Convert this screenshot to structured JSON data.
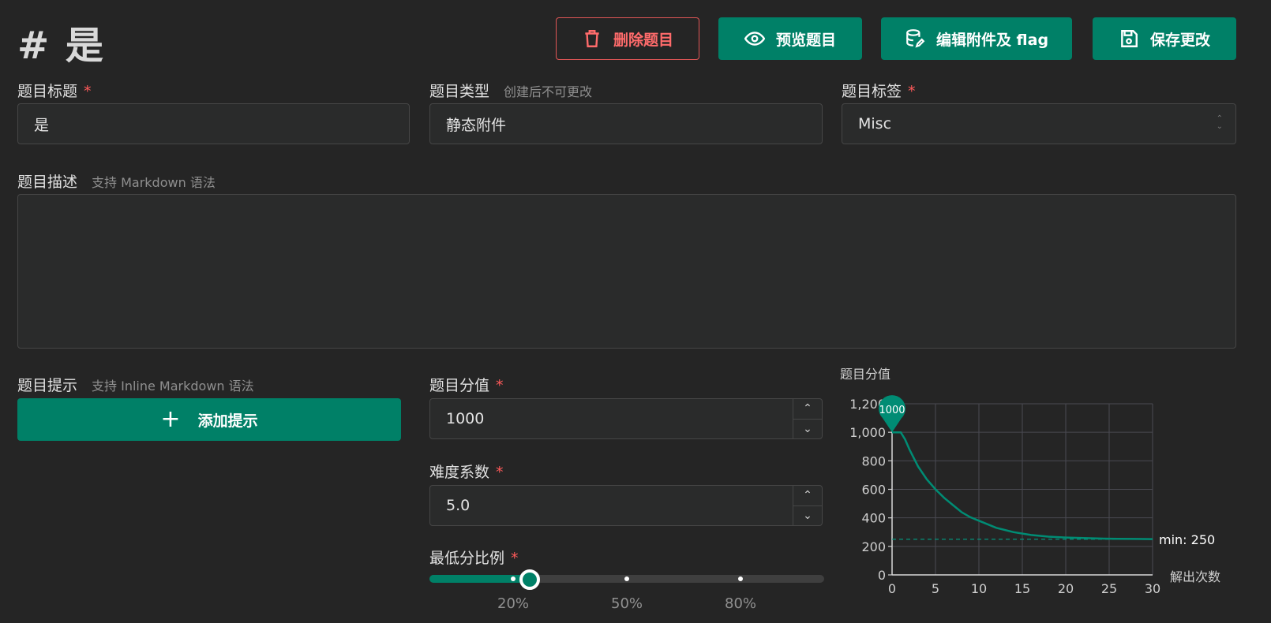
{
  "header": {
    "title": "# 是"
  },
  "toolbar": {
    "delete_label": "删除题目",
    "preview_label": "预览题目",
    "edit_attachments_label": "编辑附件及 flag",
    "save_label": "保存更改"
  },
  "form": {
    "title": {
      "label": "题目标题",
      "required": "*",
      "value": "是"
    },
    "type": {
      "label": "题目类型",
      "hint": "创建后不可更改",
      "value": "静态附件"
    },
    "tag": {
      "label": "题目标签",
      "required": "*",
      "value": "Misc"
    },
    "description": {
      "label": "题目描述",
      "hint": "支持 Markdown 语法",
      "value": ""
    },
    "hints": {
      "label": "题目提示",
      "hint": "支持 Inline Markdown 语法",
      "add_label": "添加提示"
    },
    "score": {
      "label": "题目分值",
      "required": "*",
      "value": "1000"
    },
    "difficulty": {
      "label": "难度系数",
      "required": "*",
      "value": "5.0"
    },
    "min_ratio": {
      "label": "最低分比例",
      "required": "*",
      "value": 0.25,
      "marks": [
        "20%",
        "50%",
        "80%"
      ]
    }
  },
  "colors": {
    "accent": "#008067",
    "danger": "#ff5a5a"
  },
  "chart_data": {
    "type": "line",
    "ylabel": "题目分值",
    "xlabel": "解出次数",
    "xlim": [
      0,
      30
    ],
    "ylim": [
      0,
      1200
    ],
    "xticks": [
      "0",
      "5",
      "10",
      "15",
      "20",
      "25",
      "30"
    ],
    "yticks": [
      "0",
      "200",
      "400",
      "600",
      "800",
      "1,000",
      "1,200"
    ],
    "x": [
      0,
      0.5,
      1,
      1.5,
      2,
      3,
      4,
      5,
      6,
      7,
      8,
      9,
      10,
      12,
      14,
      16,
      18,
      20,
      22,
      24,
      26,
      28,
      30
    ],
    "y": [
      1000,
      1000,
      1000,
      950,
      880,
      760,
      670,
      600,
      540,
      490,
      440,
      405,
      380,
      330,
      300,
      280,
      268,
      262,
      258,
      255,
      253,
      252,
      251
    ],
    "marker": {
      "x": 0,
      "y": 1000,
      "label": "1000"
    },
    "min_line": {
      "y": 250,
      "label": "min: 250"
    },
    "grid": true
  }
}
